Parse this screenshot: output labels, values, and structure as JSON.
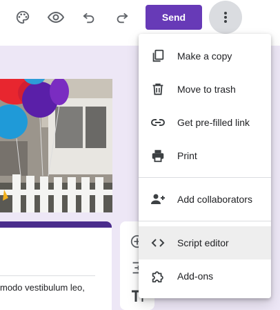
{
  "toolbar": {
    "icons": [
      "palette-icon",
      "eye-icon",
      "undo-icon",
      "redo-icon"
    ],
    "send_label": "Send",
    "more_icon": "more-vert-icon"
  },
  "menu": {
    "items": [
      {
        "label": "Make a copy",
        "icon": "copy-icon"
      },
      {
        "label": "Move to trash",
        "icon": "trash-icon"
      },
      {
        "label": "Get pre-filled link",
        "icon": "link-icon"
      },
      {
        "label": "Print",
        "icon": "printer-icon"
      },
      {
        "label": "Add collaborators",
        "icon": "person-add-icon"
      },
      {
        "label": "Script editor",
        "icon": "code-icon",
        "active": true
      },
      {
        "label": "Add-ons",
        "icon": "puzzle-icon"
      }
    ]
  },
  "card": {
    "text": "modo vestibulum leo,"
  },
  "colors": {
    "accent": "#673ab7",
    "card_bar": "#4a2c8c",
    "background": "#ede7f6",
    "menu_hover": "#eeeeee"
  }
}
